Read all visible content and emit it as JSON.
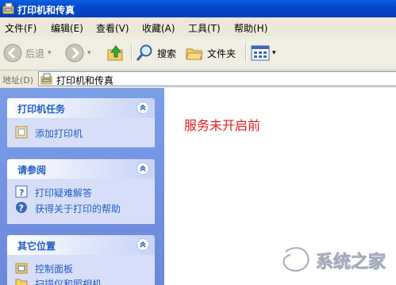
{
  "window": {
    "title": "打印机和传真"
  },
  "menubar": {
    "items": [
      "文件(F)",
      "编辑(E)",
      "查看(V)",
      "收藏(A)",
      "工具(T)",
      "帮助(H)"
    ]
  },
  "toolbar": {
    "back_label": "后退",
    "search_label": "搜索",
    "folders_label": "文件夹"
  },
  "addressbar": {
    "label": "地址(D)",
    "value": "打印机和传真"
  },
  "sidebar": {
    "panels": [
      {
        "title": "打印机任务",
        "items": [
          "添加打印机"
        ]
      },
      {
        "title": "请参阅",
        "items": [
          "打印疑难解答",
          "获得关于打印的帮助"
        ]
      },
      {
        "title": "其它位置",
        "items": [
          "控制面板",
          "扫描仪和照相机"
        ]
      }
    ]
  },
  "content": {
    "message": "服务未开启前"
  },
  "colors": {
    "titlebar": "#0a5fe0",
    "sidebar": "#7b9ee9",
    "panel_title": "#215dc6",
    "message": "#e21d1d"
  },
  "icons": [
    "printer-folder-icon",
    "back-icon",
    "forward-icon",
    "up-folder-icon",
    "search-icon",
    "folders-icon",
    "views-icon"
  ],
  "watermark": {
    "text": "系统之家"
  }
}
